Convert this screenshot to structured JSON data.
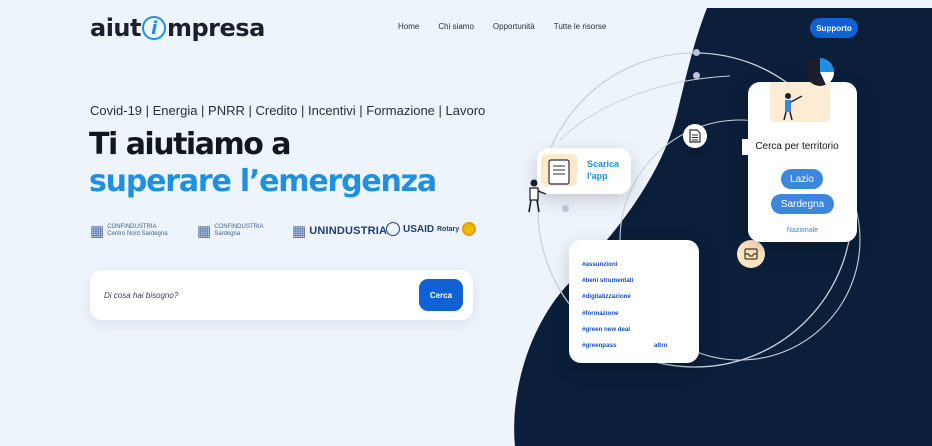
{
  "header": {
    "logo_pre": "aiut",
    "logo_i": "i",
    "logo_post": "mpresa",
    "nav": [
      "Home",
      "Chi siamo",
      "Opportunità",
      "Tutte le risorse"
    ],
    "support_label": "Supporto"
  },
  "hero": {
    "topics": "Covid-19 | Energia | PNRR | Credito | Incentivi | Formazione | Lavoro",
    "title_line1": "Ti aiutiamo a",
    "title_line2": "superare l’emergenza"
  },
  "partners": {
    "confindustria_cns_1": "CONFINDUSTRIA",
    "confindustria_cns_2": "Centro Nord Sardegna",
    "confindustria_sardegna_1": "CONFINDUSTRIA",
    "confindustria_sardegna_2": "Sardegna",
    "unindustria": "UNINDUSTRIA",
    "usaid": "USAID",
    "rotary": "Rotary"
  },
  "search": {
    "placeholder": "Di cosa hai bisogno?",
    "button_label": "Cerca"
  },
  "app_card": {
    "label_line1": "Scarica",
    "label_line2": "l'app"
  },
  "tags": {
    "items": [
      "#assunzioni",
      "#beni strumentali",
      "#digitalizzazione",
      "#formazione",
      "#green new deal",
      "#greenpass"
    ],
    "more_label": "altro"
  },
  "territory": {
    "title": "Cerca per territorio",
    "regions": [
      "Lazio",
      "Sardegna"
    ],
    "national_label": "Nazionale"
  },
  "colors": {
    "accent": "#1f8fe0",
    "button": "#0f62d6",
    "dark_wave": "#0b1f3a",
    "background": "#eef4fb",
    "pill": "#3c87dc"
  },
  "icons": [
    "document-icon",
    "inbox-icon",
    "phone-app-icon",
    "person-illustration",
    "pie-chart-illustration"
  ]
}
